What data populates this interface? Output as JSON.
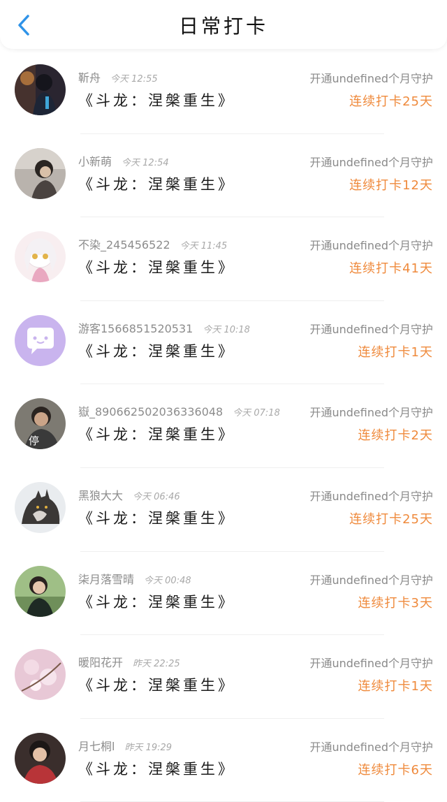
{
  "header": {
    "title": "日常打卡",
    "back_icon": "chevron-left-icon",
    "accent": "#2f93e8"
  },
  "colors": {
    "streak": "#ef8a3c",
    "muted": "#8c8c8c"
  },
  "entries": [
    {
      "name": "靳舟",
      "time": "今天 12:55",
      "book": "《斗龙：涅槃重生》",
      "guard": "开通undefined个月守护",
      "streak": "连续打卡25天",
      "avatar": "avatar-anime-boy"
    },
    {
      "name": "小新萌",
      "time": "今天 12:54",
      "book": "《斗龙：涅槃重生》",
      "guard": "开通undefined个月守护",
      "streak": "连续打卡12天",
      "avatar": "avatar-girl-dark"
    },
    {
      "name": "不染_245456522",
      "time": "今天 11:45",
      "book": "《斗龙：涅槃重生》",
      "guard": "开通undefined个月守护",
      "streak": "连续打卡41天",
      "avatar": "avatar-anime-white-hair"
    },
    {
      "name": "游客1566851520531",
      "time": "今天 10:18",
      "book": "《斗龙：涅槃重生》",
      "guard": "开通undefined个月守护",
      "streak": "连续打卡1天",
      "avatar": "avatar-default-chat"
    },
    {
      "name": "嶽_890662502036336048",
      "time": "今天 07:18",
      "book": "《斗龙：涅槃重生》",
      "guard": "开通undefined个月守护",
      "streak": "连续打卡2天",
      "avatar": "avatar-man-hat",
      "avatar_caption": "停"
    },
    {
      "name": "黑狼大大",
      "time": "今天 06:46",
      "book": "《斗龙：涅槃重生》",
      "guard": "开通undefined个月守护",
      "streak": "连续打卡25天",
      "avatar": "avatar-wolf"
    },
    {
      "name": "柒月落雪晴",
      "time": "今天 00:48",
      "book": "《斗龙：涅槃重生》",
      "guard": "开通undefined个月守护",
      "streak": "连续打卡3天",
      "avatar": "avatar-girl-outdoor"
    },
    {
      "name": "暖阳花开",
      "time": "昨天 22:25",
      "book": "《斗龙：涅槃重生》",
      "guard": "开通undefined个月守护",
      "streak": "连续打卡1天",
      "avatar": "avatar-flowers"
    },
    {
      "name": "月七桐l",
      "time": "昨天 19:29",
      "book": "《斗龙：涅槃重生》",
      "guard": "开通undefined个月守护",
      "streak": "连续打卡6天",
      "avatar": "avatar-boy-red"
    }
  ]
}
